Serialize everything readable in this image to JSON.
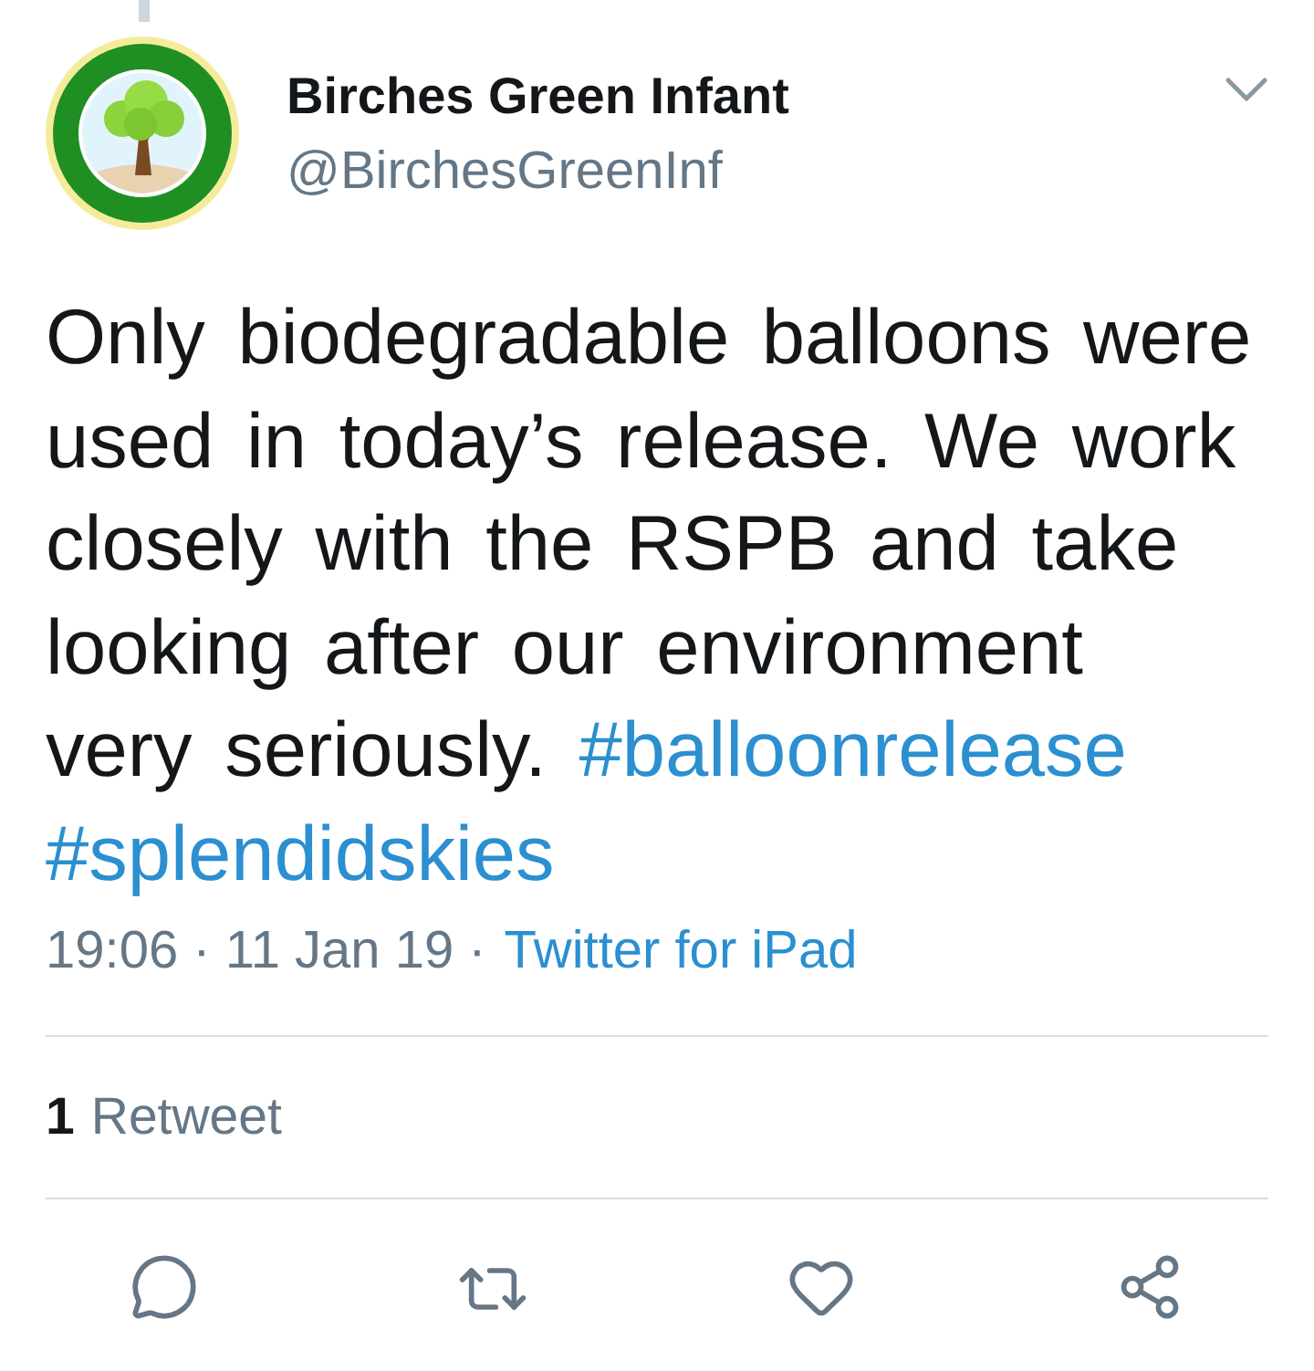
{
  "tweet": {
    "author": {
      "name": "Birches Green Infant",
      "handle": "@BirchesGreenInf"
    },
    "body": {
      "text": "Only biodegradable balloons were used in today’s release. We work closely with the RSPB and take looking after our environment very seriously.",
      "hashtags": [
        "#balloonrelease",
        "#splendidskies"
      ]
    },
    "meta": {
      "timestamp": "19:06 · 11 Jan 19 ·",
      "source": "Twitter for iPad"
    },
    "stats": [
      {
        "count": "1",
        "label": "Retweet"
      }
    ]
  }
}
